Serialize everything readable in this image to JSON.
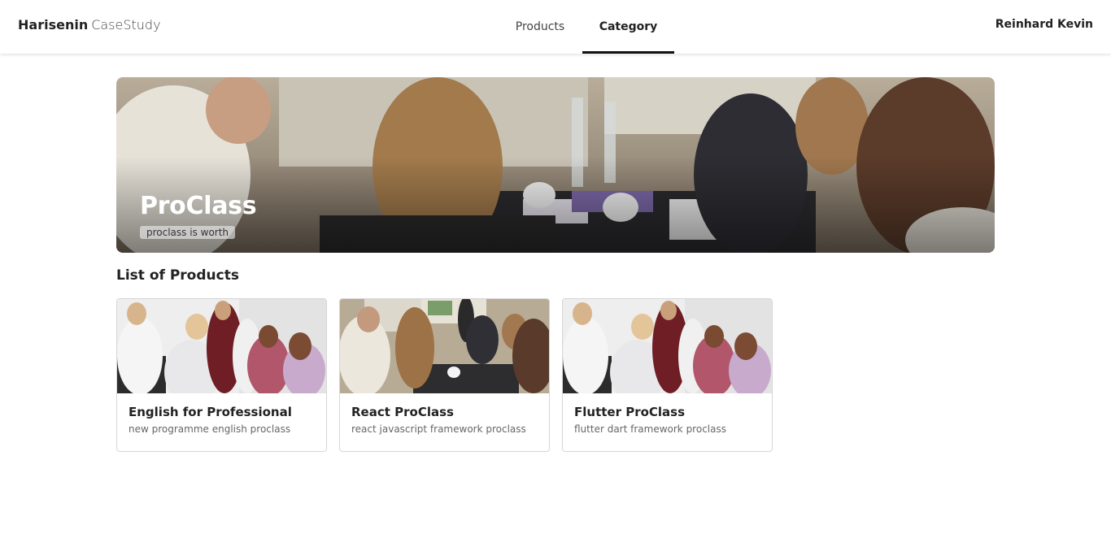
{
  "header": {
    "brand_bold": "Harisenin",
    "brand_light": "CaseStudy",
    "nav": [
      {
        "label": "Products",
        "active": false
      },
      {
        "label": "Category",
        "active": true
      }
    ],
    "user_name": "Reinhard Kevin"
  },
  "hero": {
    "title": "ProClass",
    "subtitle": "proclass is worth"
  },
  "section": {
    "title": "List of Products"
  },
  "products": [
    {
      "title": "English for Professional",
      "description": "new programme english proclass",
      "image": "team-photo"
    },
    {
      "title": "React ProClass",
      "description": "react javascript framework proclass",
      "image": "classroom-photo"
    },
    {
      "title": "Flutter ProClass",
      "description": "flutter dart framework proclass",
      "image": "team-photo"
    }
  ],
  "colors": {
    "accent": "#111111",
    "border": "#d6d6d6"
  }
}
